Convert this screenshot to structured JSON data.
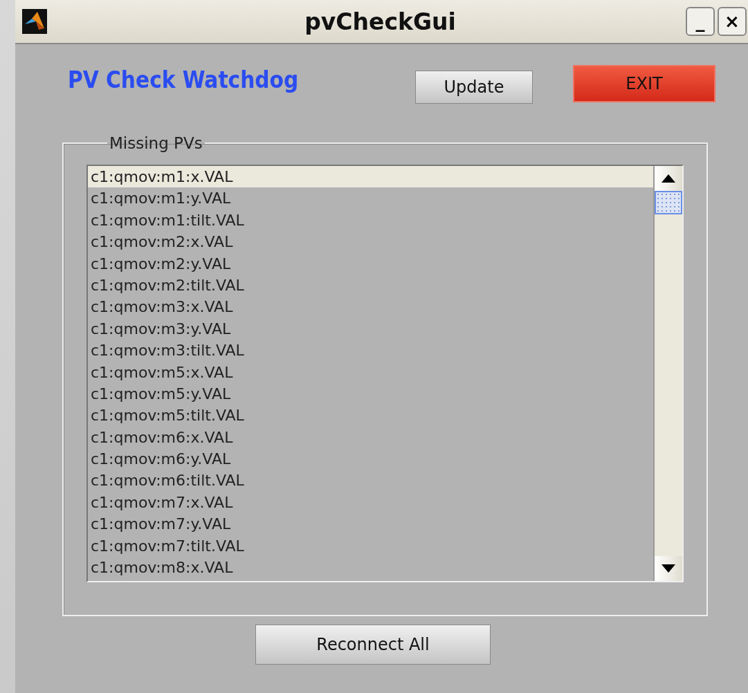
{
  "window": {
    "title": "pvCheckGui",
    "buttons": [
      "_",
      "×"
    ]
  },
  "heading": "PV Check Watchdog",
  "update_button": "Update",
  "exit_button": "EXIT",
  "missing_pvs": {
    "label": "Missing PVs",
    "items": [
      {
        "text": "c1:qmov:m1:x.VAL",
        "selected": true
      },
      {
        "text": "c1:qmov:m1:y.VAL",
        "selected": false
      },
      {
        "text": "c1:qmov:m1:tilt.VAL",
        "selected": false
      },
      {
        "text": "c1:qmov:m2:x.VAL",
        "selected": false
      },
      {
        "text": "c1:qmov:m2:y.VAL",
        "selected": false
      },
      {
        "text": "c1:qmov:m2:tilt.VAL",
        "selected": false
      },
      {
        "text": "c1:qmov:m3:x.VAL",
        "selected": false
      },
      {
        "text": "c1:qmov:m3:y.VAL",
        "selected": false
      },
      {
        "text": "c1:qmov:m3:tilt.VAL",
        "selected": false
      },
      {
        "text": "c1:qmov:m5:x.VAL",
        "selected": false
      },
      {
        "text": "c1:qmov:m5:y.VAL",
        "selected": false
      },
      {
        "text": "c1:qmov:m5:tilt.VAL",
        "selected": false
      },
      {
        "text": "c1:qmov:m6:x.VAL",
        "selected": false
      },
      {
        "text": "c1:qmov:m6:y.VAL",
        "selected": false
      },
      {
        "text": "c1:qmov:m6:tilt.VAL",
        "selected": false
      },
      {
        "text": "c1:qmov:m7:x.VAL",
        "selected": false
      },
      {
        "text": "c1:qmov:m7:y.VAL",
        "selected": false
      },
      {
        "text": "c1:qmov:m7:tilt.VAL",
        "selected": false
      },
      {
        "text": "c1:qmov:m8:x.VAL",
        "selected": false
      }
    ]
  },
  "reconnect_button": "Reconnect All"
}
